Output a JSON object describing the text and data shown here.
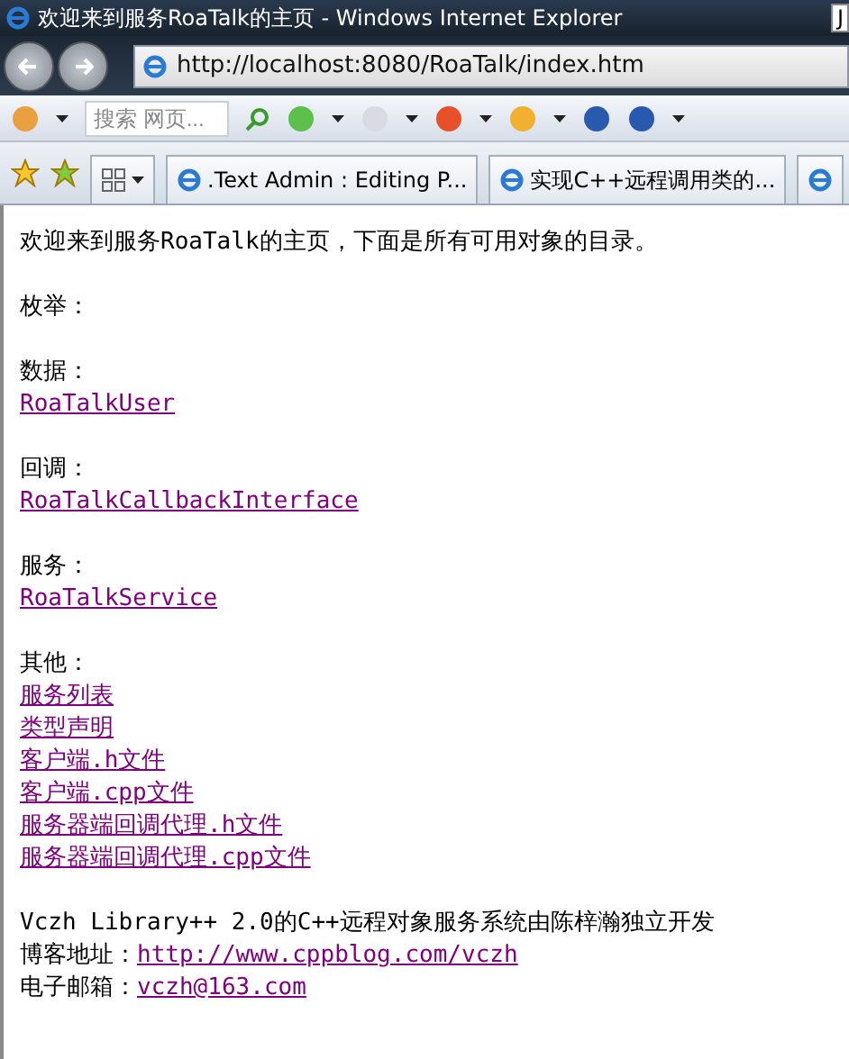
{
  "window": {
    "title": "欢迎来到服务RoaTalk的主页 - Windows Internet Explorer",
    "edge_fragment": "J"
  },
  "address": {
    "value": "http://localhost:8080/RoaTalk/index.htm"
  },
  "search": {
    "placeholder": "搜索 网页..."
  },
  "tabs": [
    {
      "kind": "full",
      "label": ".Text Admin : Editing P..."
    },
    {
      "kind": "full",
      "label": "实现C++远程调用类的..."
    },
    {
      "kind": "cut"
    }
  ],
  "page": {
    "intro": "欢迎来到服务RoaTalk的主页，下面是所有可用对象的目录。",
    "sections": [
      {
        "label": "枚举："
      },
      {
        "label": "数据：",
        "links": [
          "RoaTalkUser"
        ]
      },
      {
        "label": "回调：",
        "links": [
          "RoaTalkCallbackInterface"
        ]
      },
      {
        "label": "服务：",
        "links": [
          "RoaTalkService"
        ]
      },
      {
        "label": "其他：",
        "links": [
          "服务列表",
          "类型声明",
          "客户端.h文件",
          "客户端.cpp文件",
          "服务器端回调代理.h文件",
          "服务器端回调代理.cpp文件"
        ]
      }
    ],
    "footer": [
      {
        "text": "Vczh Library++ 2.0的C++远程对象服务系统由陈梓瀚独立开发"
      },
      {
        "text": "博客地址：",
        "link": "http://www.cppblog.com/vczh"
      },
      {
        "text": "电子邮箱：",
        "link": "vczh@163.com"
      }
    ]
  }
}
